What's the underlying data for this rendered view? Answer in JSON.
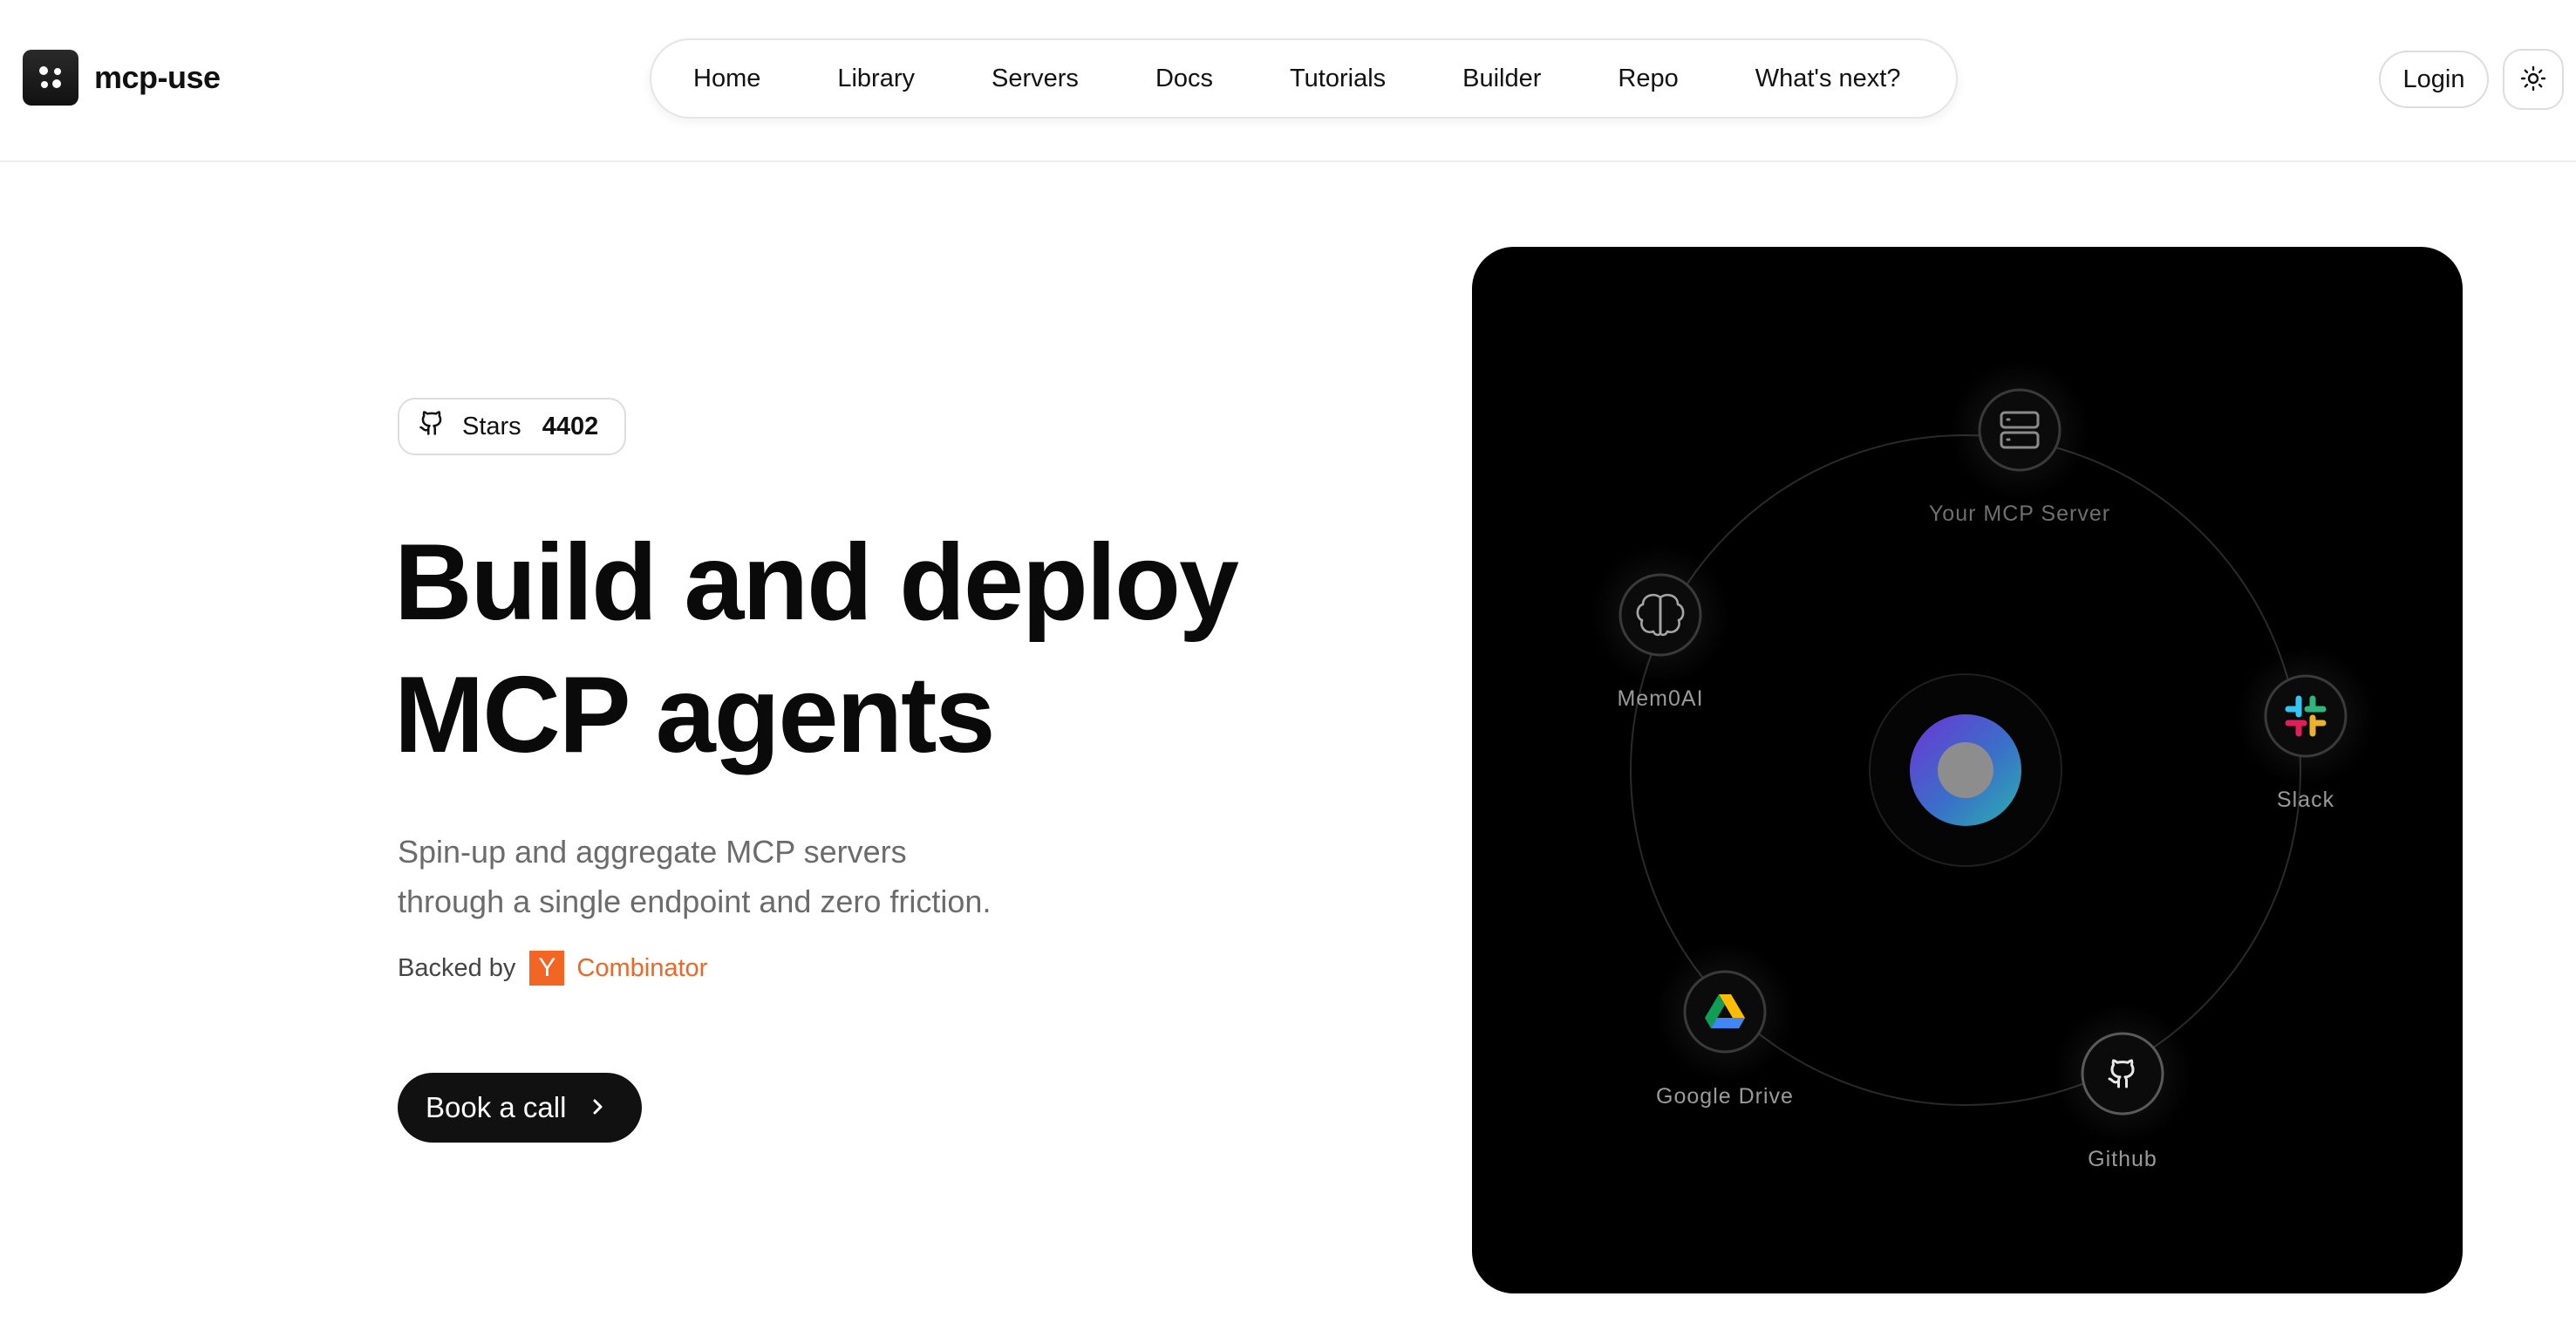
{
  "brand": {
    "name": "mcp-use",
    "logo_icon": "four-dots-icon"
  },
  "nav": {
    "items": [
      {
        "label": "Home"
      },
      {
        "label": "Library"
      },
      {
        "label": "Servers"
      },
      {
        "label": "Docs"
      },
      {
        "label": "Tutorials"
      },
      {
        "label": "Builder"
      },
      {
        "label": "Repo"
      },
      {
        "label": "What's next?"
      }
    ]
  },
  "header_actions": {
    "login_label": "Login",
    "theme_icon": "sun-icon"
  },
  "stars_badge": {
    "icon": "github-icon",
    "label": "Stars",
    "count": "4402"
  },
  "hero": {
    "title_line1": "Build and deploy",
    "title_line2": "MCP agents",
    "subtitle_line1": "Spin-up and aggregate MCP servers",
    "subtitle_line2": "through a single endpoint and zero friction.",
    "backed_label": "Backed by",
    "backer_logo_letter": "Y",
    "backer_name": "Combinator",
    "cta_label": "Book a call",
    "cta_icon": "chevron-right-icon"
  },
  "diagram": {
    "nodes": [
      {
        "label": "Your MCP Server",
        "icon": "server-icon"
      },
      {
        "label": "Mem0AI",
        "icon": "brain-icon"
      },
      {
        "label": "Slack",
        "icon": "slack-icon"
      },
      {
        "label": "Google Drive",
        "icon": "google-drive-icon"
      },
      {
        "label": "Github",
        "icon": "github-icon"
      }
    ],
    "center_icon": "orb-icon"
  },
  "colors": {
    "accent_dark": "#111111",
    "yc_orange": "#f26522",
    "panel_bg": "#000000"
  }
}
